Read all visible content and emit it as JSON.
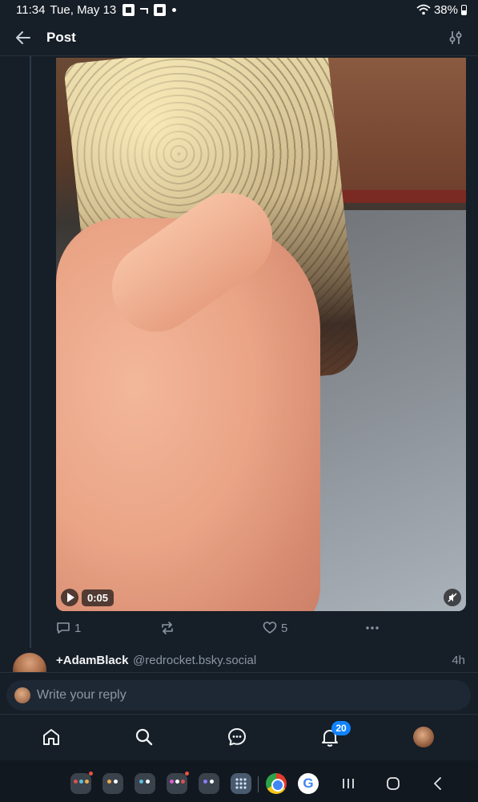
{
  "status_bar": {
    "time": "11:34",
    "date": "Tue, May 13",
    "battery": "38%"
  },
  "header": {
    "title": "Post"
  },
  "media": {
    "duration": "0:05"
  },
  "post_actions": {
    "reply_count": "1",
    "like_count": "5"
  },
  "next_post": {
    "display_name": "+AdamBlack",
    "handle": "@redrocket.bsky.social",
    "time": "4h"
  },
  "reply_bar": {
    "placeholder": "Write your reply"
  },
  "bottom_nav": {
    "notification_badge": "20"
  },
  "colors": {
    "background": "#161e27",
    "accent": "#1083fe",
    "muted_text": "#8b97a6"
  }
}
